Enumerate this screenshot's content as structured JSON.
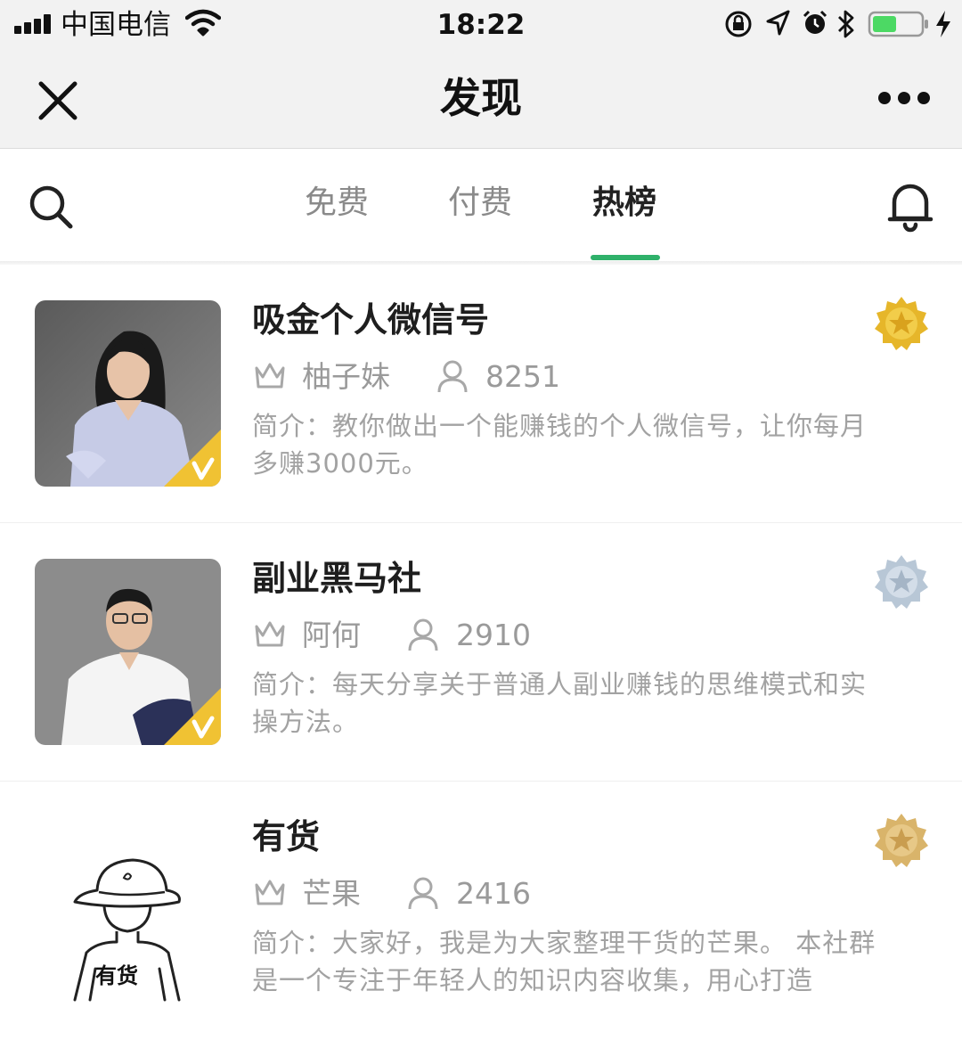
{
  "status_bar": {
    "carrier": "中国电信",
    "time": "18:22"
  },
  "nav": {
    "title": "发现"
  },
  "tabs": [
    {
      "label": "免费",
      "active": false
    },
    {
      "label": "付费",
      "active": false
    },
    {
      "label": "热榜",
      "active": true
    }
  ],
  "colors": {
    "accent": "#2fb16a",
    "gold": "#e6b62a",
    "silver": "#b8c7d6",
    "bronze": "#d9b46a",
    "v_badge": "#f0c233"
  },
  "items": [
    {
      "title": "吸金个人微信号",
      "owner": "柚子妹",
      "members": "8251",
      "desc": "简介：教你做出一个能赚钱的个人微信号，让你每月多赚3000元。",
      "rank": "gold-star-badge",
      "verified": true
    },
    {
      "title": "副业黑马社",
      "owner": "阿何",
      "members": "2910",
      "desc": "简介：每天分享关于普通人副业赚钱的思维模式和实操方法。",
      "rank": "silver-star-badge",
      "verified": true
    },
    {
      "title": "有货",
      "owner": "芒果",
      "members": "2416",
      "desc": "简介：大家好，我是为大家整理干货的芒果。 本社群是一个专注于年轻人的知识内容收集，用心打造",
      "avatar_text": "有货",
      "rank": "bronze-star-badge",
      "verified": false
    }
  ]
}
